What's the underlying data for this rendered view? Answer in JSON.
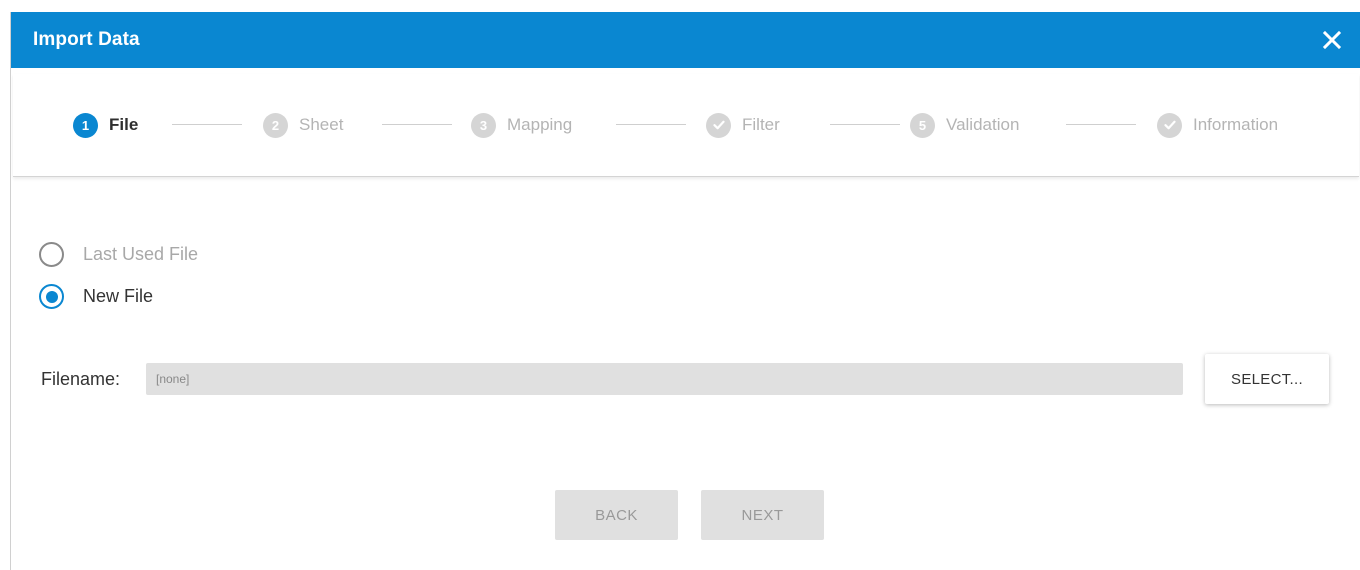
{
  "dialog": {
    "title": "Import Data",
    "close_icon": "close-icon",
    "accent": "#0a87d1"
  },
  "stepper": {
    "steps": [
      {
        "number": "1",
        "label": "File",
        "state": "active"
      },
      {
        "number": "2",
        "label": "Sheet",
        "state": "inactive"
      },
      {
        "number": "3",
        "label": "Mapping",
        "state": "inactive"
      },
      {
        "number": "",
        "icon": "check-icon",
        "label": "Filter",
        "state": "inactive"
      },
      {
        "number": "5",
        "label": "Validation",
        "state": "inactive"
      },
      {
        "number": "",
        "icon": "check-icon",
        "label": "Information",
        "state": "inactive"
      }
    ]
  },
  "source": {
    "options": [
      {
        "label": "Last Used File",
        "selected": false,
        "enabled": false
      },
      {
        "label": "New File",
        "selected": true,
        "enabled": true
      }
    ]
  },
  "file": {
    "label": "Filename:",
    "value": "[none]",
    "select_label": "SELECT..."
  },
  "footer": {
    "back_label": "BACK",
    "next_label": "NEXT"
  }
}
